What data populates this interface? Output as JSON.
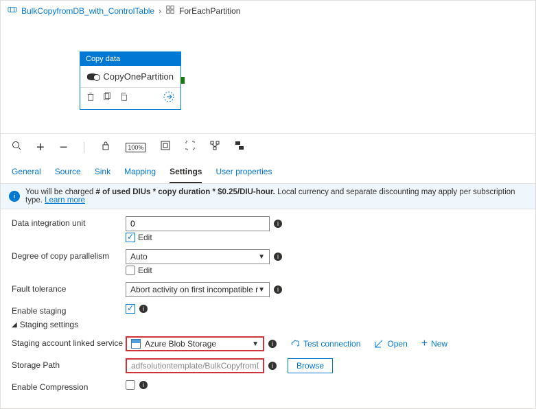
{
  "breadcrumb": {
    "root": "BulkCopyfromDB_with_ControlTable",
    "current": "ForEachPartition"
  },
  "activity": {
    "header": "Copy data",
    "name": "CopyOnePartition"
  },
  "tabs": {
    "general": "General",
    "source": "Source",
    "sink": "Sink",
    "mapping": "Mapping",
    "settings": "Settings",
    "userprops": "User properties"
  },
  "banner": {
    "pre": "You will be charged ",
    "bold": "# of used DIUs * copy duration * $0.25/DIU-hour.",
    "post": " Local currency and separate discounting may apply per subscription type. ",
    "link": "Learn more"
  },
  "form": {
    "diu_label": "Data integration unit",
    "diu_value": "0",
    "edit": "Edit",
    "parallel_label": "Degree of copy parallelism",
    "parallel_value": "Auto",
    "fault_label": "Fault tolerance",
    "fault_value": "Abort activity on first incompatible row",
    "staging_label": "Enable staging",
    "staging_section": "Staging settings",
    "linked_label": "Staging account linked service",
    "linked_value": "Azure Blob Storage",
    "test": "Test connection",
    "open": "Open",
    "new": "New",
    "path_label": "Storage Path",
    "path_value": "adfsolutiontemplate/BulkCopyfromDB_with_Co",
    "browse": "Browse",
    "compress_label": "Enable Compression"
  }
}
